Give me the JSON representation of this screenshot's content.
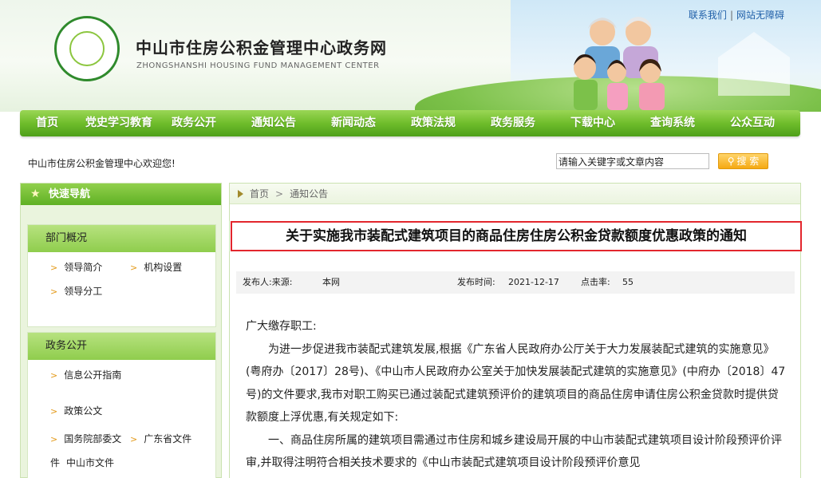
{
  "header": {
    "site_title": "中山市住房公积金管理中心政务网",
    "site_subtitle": "ZHONGSHANSHI HOUSING FUND MANAGEMENT CENTER",
    "logo_text": "中山市住房公积金管理中心",
    "top_links": [
      "联系我们",
      "网站无障碍"
    ]
  },
  "nav": {
    "items": [
      "首页",
      "党史学习教育",
      "政务公开",
      "通知公告",
      "新闻动态",
      "政策法规",
      "政务服务",
      "下载中心",
      "查询系统",
      "公众互动"
    ]
  },
  "toolbar": {
    "welcome": "中山市住房公积金管理中心欢迎您!",
    "search_value": "请输入关键字或文章内容",
    "search_button": "搜 索"
  },
  "sidebar": {
    "quick_nav_title": "快速导航",
    "sections": [
      {
        "title": "部门概况",
        "links": [
          "领导简介",
          "机构设置",
          "领导分工"
        ]
      },
      {
        "title": "政务公开",
        "links": [
          "信息公开指南",
          "政策公文",
          "国务院部委文",
          "广东省文件",
          "件",
          "中山市文件"
        ]
      }
    ]
  },
  "breadcrumb": [
    "首页",
    "通知公告"
  ],
  "article": {
    "title": "关于实施我市装配式建筑项目的商品住房住房公积金贷款额度优惠政策的通知",
    "meta": {
      "publisher_label": "发布人:来源:",
      "source": "本网",
      "date_label": "发布时间:",
      "date": "2021-12-17",
      "clicks_label": "点击率:",
      "clicks": "55"
    },
    "greeting": "广大缴存职工:",
    "paragraphs": [
      "为进一步促进我市装配式建筑发展,根据《广东省人民政府办公厅关于大力发展装配式建筑的实施意见》(粤府办〔2017〕28号)、《中山市人民政府办公室关于加快发展装配式建筑的实施意见》(中府办〔2018〕47号)的文件要求,我市对职工购买已通过装配式建筑预评价的建筑项目的商品住房申请住房公积金贷款时提供贷款额度上浮优惠,有关规定如下:",
      "一、商品住房所属的建筑项目需通过市住房和城乡建设局开展的中山市装配式建筑项目设计阶段预评价评审,并取得注明符合相关技术要求的《中山市装配式建筑项目设计阶段预评价意见"
    ]
  }
}
